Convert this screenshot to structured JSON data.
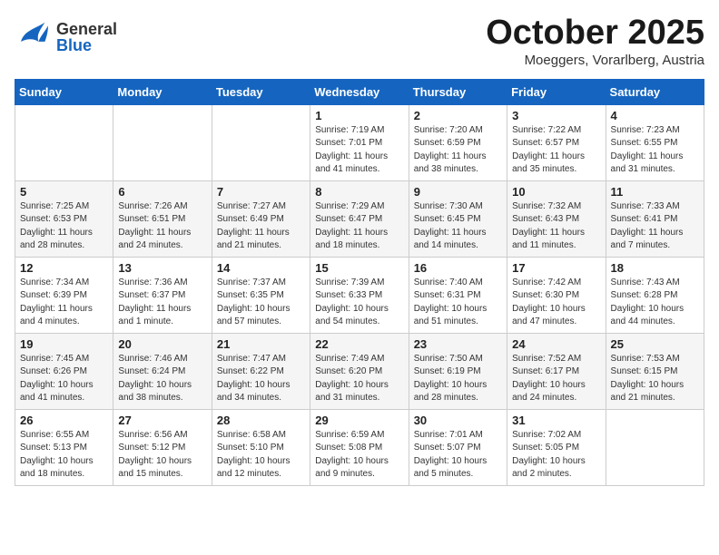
{
  "header": {
    "month": "October 2025",
    "location": "Moeggers, Vorarlberg, Austria",
    "logo_general": "General",
    "logo_blue": "Blue"
  },
  "weekdays": [
    "Sunday",
    "Monday",
    "Tuesday",
    "Wednesday",
    "Thursday",
    "Friday",
    "Saturday"
  ],
  "weeks": [
    [
      {
        "day": "",
        "info": ""
      },
      {
        "day": "",
        "info": ""
      },
      {
        "day": "",
        "info": ""
      },
      {
        "day": "1",
        "info": "Sunrise: 7:19 AM\nSunset: 7:01 PM\nDaylight: 11 hours\nand 41 minutes."
      },
      {
        "day": "2",
        "info": "Sunrise: 7:20 AM\nSunset: 6:59 PM\nDaylight: 11 hours\nand 38 minutes."
      },
      {
        "day": "3",
        "info": "Sunrise: 7:22 AM\nSunset: 6:57 PM\nDaylight: 11 hours\nand 35 minutes."
      },
      {
        "day": "4",
        "info": "Sunrise: 7:23 AM\nSunset: 6:55 PM\nDaylight: 11 hours\nand 31 minutes."
      }
    ],
    [
      {
        "day": "5",
        "info": "Sunrise: 7:25 AM\nSunset: 6:53 PM\nDaylight: 11 hours\nand 28 minutes."
      },
      {
        "day": "6",
        "info": "Sunrise: 7:26 AM\nSunset: 6:51 PM\nDaylight: 11 hours\nand 24 minutes."
      },
      {
        "day": "7",
        "info": "Sunrise: 7:27 AM\nSunset: 6:49 PM\nDaylight: 11 hours\nand 21 minutes."
      },
      {
        "day": "8",
        "info": "Sunrise: 7:29 AM\nSunset: 6:47 PM\nDaylight: 11 hours\nand 18 minutes."
      },
      {
        "day": "9",
        "info": "Sunrise: 7:30 AM\nSunset: 6:45 PM\nDaylight: 11 hours\nand 14 minutes."
      },
      {
        "day": "10",
        "info": "Sunrise: 7:32 AM\nSunset: 6:43 PM\nDaylight: 11 hours\nand 11 minutes."
      },
      {
        "day": "11",
        "info": "Sunrise: 7:33 AM\nSunset: 6:41 PM\nDaylight: 11 hours\nand 7 minutes."
      }
    ],
    [
      {
        "day": "12",
        "info": "Sunrise: 7:34 AM\nSunset: 6:39 PM\nDaylight: 11 hours\nand 4 minutes."
      },
      {
        "day": "13",
        "info": "Sunrise: 7:36 AM\nSunset: 6:37 PM\nDaylight: 11 hours\nand 1 minute."
      },
      {
        "day": "14",
        "info": "Sunrise: 7:37 AM\nSunset: 6:35 PM\nDaylight: 10 hours\nand 57 minutes."
      },
      {
        "day": "15",
        "info": "Sunrise: 7:39 AM\nSunset: 6:33 PM\nDaylight: 10 hours\nand 54 minutes."
      },
      {
        "day": "16",
        "info": "Sunrise: 7:40 AM\nSunset: 6:31 PM\nDaylight: 10 hours\nand 51 minutes."
      },
      {
        "day": "17",
        "info": "Sunrise: 7:42 AM\nSunset: 6:30 PM\nDaylight: 10 hours\nand 47 minutes."
      },
      {
        "day": "18",
        "info": "Sunrise: 7:43 AM\nSunset: 6:28 PM\nDaylight: 10 hours\nand 44 minutes."
      }
    ],
    [
      {
        "day": "19",
        "info": "Sunrise: 7:45 AM\nSunset: 6:26 PM\nDaylight: 10 hours\nand 41 minutes."
      },
      {
        "day": "20",
        "info": "Sunrise: 7:46 AM\nSunset: 6:24 PM\nDaylight: 10 hours\nand 38 minutes."
      },
      {
        "day": "21",
        "info": "Sunrise: 7:47 AM\nSunset: 6:22 PM\nDaylight: 10 hours\nand 34 minutes."
      },
      {
        "day": "22",
        "info": "Sunrise: 7:49 AM\nSunset: 6:20 PM\nDaylight: 10 hours\nand 31 minutes."
      },
      {
        "day": "23",
        "info": "Sunrise: 7:50 AM\nSunset: 6:19 PM\nDaylight: 10 hours\nand 28 minutes."
      },
      {
        "day": "24",
        "info": "Sunrise: 7:52 AM\nSunset: 6:17 PM\nDaylight: 10 hours\nand 24 minutes."
      },
      {
        "day": "25",
        "info": "Sunrise: 7:53 AM\nSunset: 6:15 PM\nDaylight: 10 hours\nand 21 minutes."
      }
    ],
    [
      {
        "day": "26",
        "info": "Sunrise: 6:55 AM\nSunset: 5:13 PM\nDaylight: 10 hours\nand 18 minutes."
      },
      {
        "day": "27",
        "info": "Sunrise: 6:56 AM\nSunset: 5:12 PM\nDaylight: 10 hours\nand 15 minutes."
      },
      {
        "day": "28",
        "info": "Sunrise: 6:58 AM\nSunset: 5:10 PM\nDaylight: 10 hours\nand 12 minutes."
      },
      {
        "day": "29",
        "info": "Sunrise: 6:59 AM\nSunset: 5:08 PM\nDaylight: 10 hours\nand 9 minutes."
      },
      {
        "day": "30",
        "info": "Sunrise: 7:01 AM\nSunset: 5:07 PM\nDaylight: 10 hours\nand 5 minutes."
      },
      {
        "day": "31",
        "info": "Sunrise: 7:02 AM\nSunset: 5:05 PM\nDaylight: 10 hours\nand 2 minutes."
      },
      {
        "day": "",
        "info": ""
      }
    ]
  ]
}
